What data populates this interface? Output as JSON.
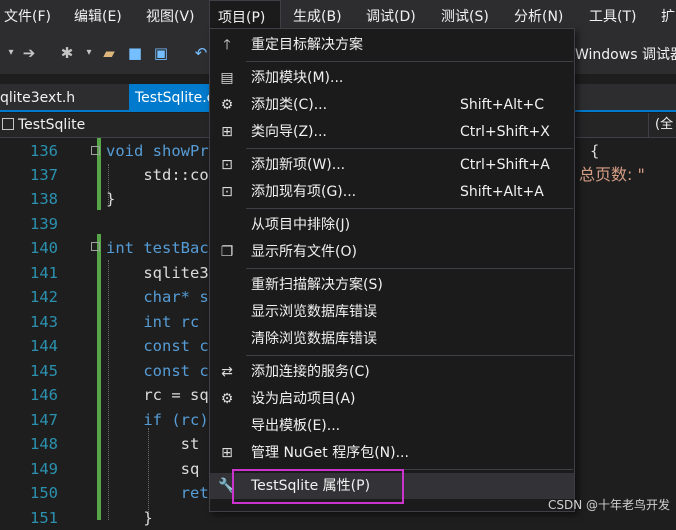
{
  "menubar": {
    "items": [
      "文件(F)",
      "编辑(E)",
      "视图(V)",
      "项目(P)",
      "生成(B)",
      "调试(D)",
      "测试(S)",
      "分析(N)",
      "工具(T)",
      "扩"
    ]
  },
  "toolbar": {
    "debug_target": "Windows 调试器"
  },
  "tabs": [
    {
      "label": "qlite3ext.h"
    },
    {
      "label": "TestSqlite.cpp"
    }
  ],
  "navbar": {
    "project": "TestSqlite",
    "scope": "(全"
  },
  "editor": {
    "lines": [
      {
        "num": "136",
        "code": "void showPr"
      },
      {
        "num": "137",
        "code": "    std::co"
      },
      {
        "num": "138",
        "code": "}"
      },
      {
        "num": "139",
        "code": ""
      },
      {
        "num": "140",
        "code": "int testBac"
      },
      {
        "num": "141",
        "code": "    sqlite3"
      },
      {
        "num": "142",
        "code": "    char* s"
      },
      {
        "num": "143",
        "code": "    int rc"
      },
      {
        "num": "144",
        "code": "    const c"
      },
      {
        "num": "145",
        "code": "    const c"
      },
      {
        "num": "146",
        "code": "    rc = sq"
      },
      {
        "num": "147",
        "code": "    if (rc)"
      },
      {
        "num": "148",
        "code": "        st"
      },
      {
        "num": "149",
        "code": "        sq"
      },
      {
        "num": "150",
        "code": "        ret"
      },
      {
        "num": "151",
        "code": "    }"
      }
    ],
    "right_fragments": {
      "brace": "{",
      "text": "总页数: \""
    }
  },
  "menu": {
    "items": [
      {
        "icon": "arrow-up-icon",
        "label": "重定目标解决方案",
        "shortcut": ""
      },
      {
        "icon": "add-module-icon",
        "label": "添加模块(M)...",
        "shortcut": ""
      },
      {
        "icon": "add-class-icon",
        "label": "添加类(C)...",
        "shortcut": "Shift+Alt+C"
      },
      {
        "icon": "class-wizard-icon",
        "label": "类向导(Z)...",
        "shortcut": "Ctrl+Shift+X"
      },
      {
        "icon": "new-item-icon",
        "label": "添加新项(W)...",
        "shortcut": "Ctrl+Shift+A"
      },
      {
        "icon": "existing-item-icon",
        "label": "添加现有项(G)...",
        "shortcut": "Shift+Alt+A"
      },
      {
        "icon": "",
        "label": "从项目中排除(J)",
        "shortcut": ""
      },
      {
        "icon": "show-all-files-icon",
        "label": "显示所有文件(O)",
        "shortcut": ""
      },
      {
        "icon": "",
        "label": "重新扫描解决方案(S)",
        "shortcut": ""
      },
      {
        "icon": "",
        "label": "显示浏览数据库错误",
        "shortcut": ""
      },
      {
        "icon": "",
        "label": "清除浏览数据库错误",
        "shortcut": ""
      },
      {
        "icon": "connected-service-icon",
        "label": "添加连接的服务(C)",
        "shortcut": ""
      },
      {
        "icon": "gear-icon",
        "label": "设为启动项目(A)",
        "shortcut": ""
      },
      {
        "icon": "",
        "label": "导出模板(E)...",
        "shortcut": ""
      },
      {
        "icon": "nuget-icon",
        "label": "管理 NuGet 程序包(N)...",
        "shortcut": ""
      },
      {
        "icon": "wrench-icon",
        "label": "TestSqlite 属性(P)",
        "shortcut": ""
      }
    ]
  },
  "watermark": "CSDN @十年老鸟开发",
  "colors": {
    "accent": "#007acc",
    "callout": "#cc33cc",
    "menu_bg": "#1b1b1c",
    "line_number": "#2b91af",
    "keyword": "#569cd6"
  }
}
